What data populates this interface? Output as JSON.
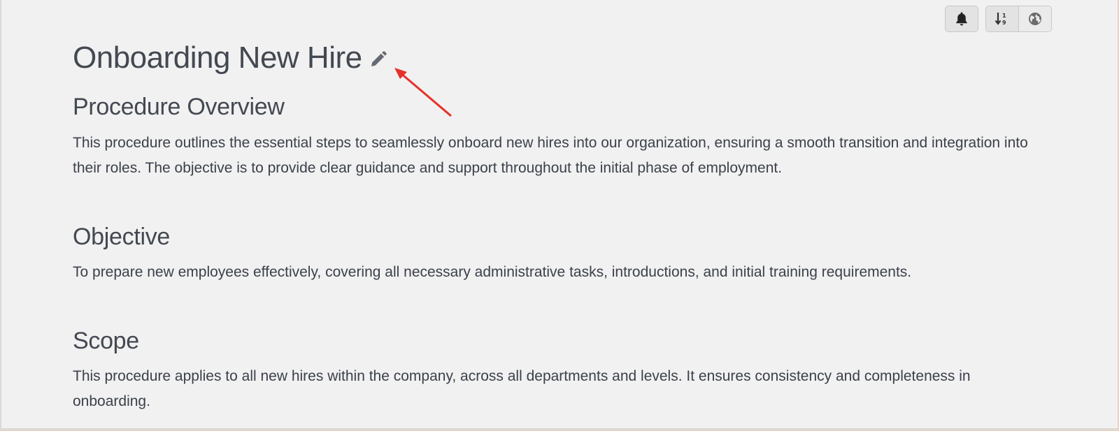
{
  "toolbar": {
    "notifications_icon": "bell-icon",
    "sort_icon": "sort-numeric-icon",
    "language_icon": "globe-icon"
  },
  "document": {
    "title": "Onboarding New Hire",
    "edit_icon": "pencil-icon",
    "sections": [
      {
        "heading": "Procedure Overview",
        "body": "This procedure outlines the essential steps to seamlessly onboard new hires into our organization, ensuring a smooth transition and integration into their roles. The objective is to provide clear guidance and support throughout the initial phase of employment."
      },
      {
        "heading": "Objective",
        "body": "To prepare new employees effectively, covering all necessary administrative tasks, introductions, and initial training requirements."
      },
      {
        "heading": "Scope",
        "body": "This procedure applies to all new hires within the company, across all departments and levels. It ensures consistency and completeness in onboarding."
      }
    ]
  },
  "annotation": {
    "arrow_color": "#e5312a"
  }
}
